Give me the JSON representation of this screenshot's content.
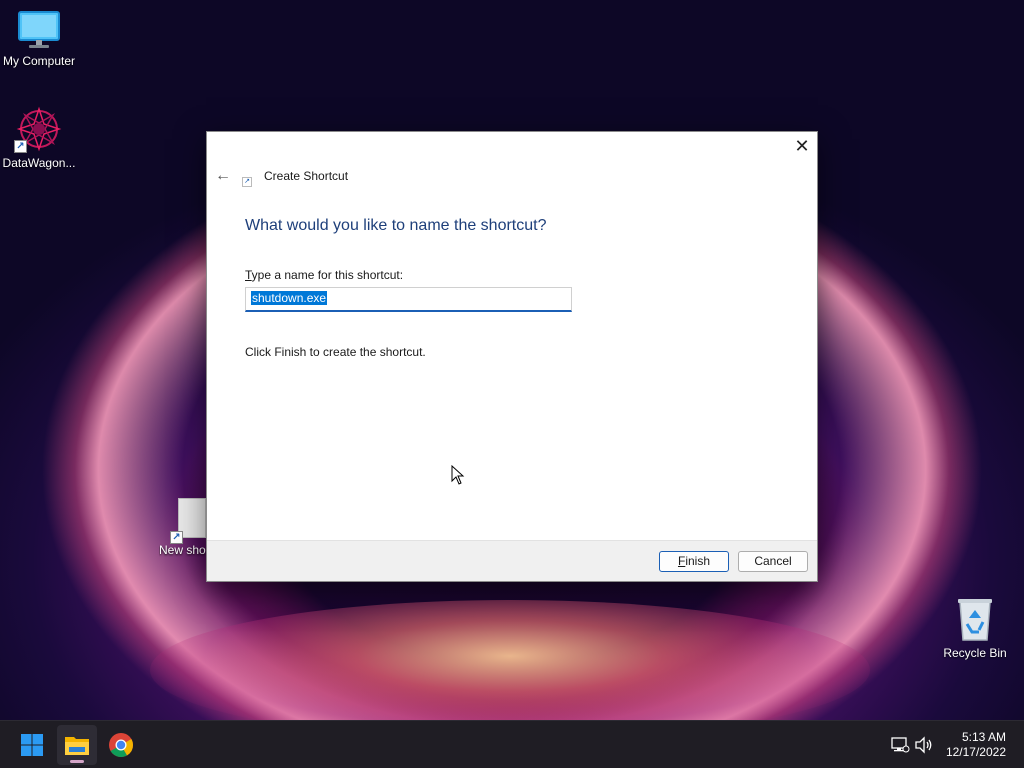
{
  "desktop": {
    "icons": [
      {
        "label": "My Computer"
      },
      {
        "label": "DataWagon..."
      },
      {
        "label": "New sho"
      },
      {
        "label": "Recycle Bin"
      }
    ]
  },
  "dialog": {
    "title": "Create Shortcut",
    "heading": "What would you like to name the shortcut?",
    "field_label_accel": "T",
    "field_label_rest": "ype a name for this shortcut:",
    "input_value": "shutdown.exe",
    "note": "Click Finish to create the shortcut.",
    "finish_accel": "F",
    "finish_rest": "inish",
    "cancel_label": "Cancel",
    "close_glyph": "✕",
    "back_glyph": "←"
  },
  "taskbar": {
    "time": "5:13 AM",
    "date": "12/17/2022",
    "apps": [
      "start-icon",
      "file-explorer-icon",
      "chrome-icon"
    ]
  },
  "colors": {
    "accent": "#1b5fb5",
    "heading": "#1e3f7a",
    "selection": "#0078d7"
  }
}
